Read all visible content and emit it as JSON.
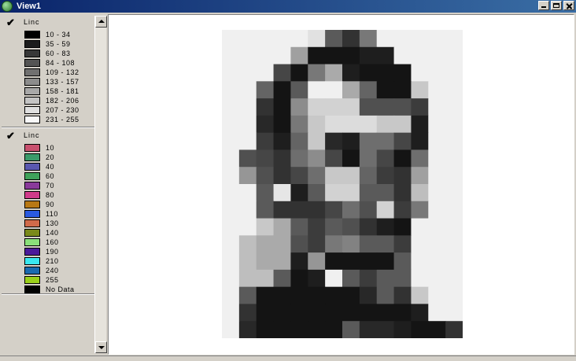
{
  "window": {
    "title": "View1"
  },
  "toc": {
    "groups": [
      {
        "name": "Linc",
        "checked": true,
        "items": [
          {
            "label": "10 - 34",
            "color": "#000000"
          },
          {
            "label": "35 - 59",
            "color": "#1c1c1c"
          },
          {
            "label": "60 - 83",
            "color": "#383838"
          },
          {
            "label": "84 - 108",
            "color": "#545454"
          },
          {
            "label": "109 - 132",
            "color": "#707070"
          },
          {
            "label": "133 - 157",
            "color": "#8c8c8c"
          },
          {
            "label": "158 - 181",
            "color": "#a8a8a8"
          },
          {
            "label": "182 - 206",
            "color": "#c4c4c4"
          },
          {
            "label": "207 - 230",
            "color": "#e0e0e0"
          },
          {
            "label": "231 - 255",
            "color": "#f8f8f8"
          }
        ]
      },
      {
        "name": "Linc",
        "checked": true,
        "items": [
          {
            "label": "10",
            "color": "#c8506e"
          },
          {
            "label": "20",
            "color": "#3a9a6a"
          },
          {
            "label": "40",
            "color": "#5a58b0"
          },
          {
            "label": "60",
            "color": "#3fa25a"
          },
          {
            "label": "70",
            "color": "#8a3a9a"
          },
          {
            "label": "80",
            "color": "#d03a8a"
          },
          {
            "label": "90",
            "color": "#b87814"
          },
          {
            "label": "110",
            "color": "#2a5ae0"
          },
          {
            "label": "130",
            "color": "#d06a4a"
          },
          {
            "label": "140",
            "color": "#7a8a1a"
          },
          {
            "label": "160",
            "color": "#8ae07a"
          },
          {
            "label": "190",
            "color": "#4a1a9a"
          },
          {
            "label": "210",
            "color": "#3ae8f0"
          },
          {
            "label": "240",
            "color": "#1a6ab0"
          },
          {
            "label": "255",
            "color": "#9ad01a"
          },
          {
            "label": "No Data",
            "color": "#000000"
          }
        ]
      }
    ]
  },
  "raster": {
    "cols": 14,
    "rows": 18,
    "values": [
      [
        240,
        240,
        240,
        240,
        240,
        225,
        90,
        50,
        120,
        240,
        240,
        240,
        240,
        240
      ],
      [
        240,
        240,
        240,
        240,
        160,
        20,
        20,
        20,
        30,
        30,
        240,
        240,
        240,
        240
      ],
      [
        240,
        240,
        240,
        70,
        20,
        120,
        170,
        30,
        20,
        20,
        20,
        240,
        240,
        240
      ],
      [
        240,
        240,
        100,
        20,
        90,
        240,
        240,
        170,
        100,
        20,
        20,
        200,
        240,
        240
      ],
      [
        240,
        240,
        50,
        20,
        140,
        210,
        210,
        210,
        80,
        80,
        80,
        60,
        240,
        240
      ],
      [
        240,
        240,
        40,
        20,
        120,
        200,
        220,
        220,
        220,
        200,
        200,
        30,
        240,
        240
      ],
      [
        240,
        240,
        60,
        30,
        100,
        200,
        40,
        30,
        110,
        110,
        70,
        30,
        240,
        240
      ],
      [
        240,
        80,
        70,
        50,
        110,
        140,
        70,
        20,
        110,
        70,
        20,
        110,
        240,
        240
      ],
      [
        240,
        150,
        80,
        50,
        70,
        110,
        200,
        200,
        100,
        60,
        50,
        160,
        240,
        240
      ],
      [
        240,
        240,
        90,
        230,
        30,
        90,
        210,
        210,
        90,
        90,
        50,
        190,
        240,
        240
      ],
      [
        240,
        240,
        90,
        50,
        50,
        50,
        70,
        110,
        80,
        210,
        60,
        120,
        240,
        240
      ],
      [
        240,
        240,
        200,
        170,
        90,
        60,
        90,
        80,
        50,
        30,
        20,
        240,
        240,
        240
      ],
      [
        240,
        190,
        170,
        170,
        80,
        60,
        120,
        130,
        90,
        90,
        60,
        240,
        240,
        240
      ],
      [
        240,
        190,
        170,
        170,
        30,
        150,
        20,
        20,
        20,
        20,
        90,
        240,
        240,
        240
      ],
      [
        240,
        190,
        190,
        90,
        20,
        30,
        240,
        90,
        60,
        90,
        90,
        240,
        240,
        240
      ],
      [
        240,
        90,
        20,
        20,
        20,
        20,
        20,
        20,
        40,
        90,
        50,
        200,
        240,
        240
      ],
      [
        240,
        50,
        20,
        20,
        20,
        20,
        20,
        20,
        20,
        20,
        20,
        30,
        240,
        240
      ],
      [
        240,
        40,
        20,
        20,
        20,
        20,
        20,
        90,
        40,
        40,
        30,
        20,
        20,
        50
      ]
    ]
  }
}
